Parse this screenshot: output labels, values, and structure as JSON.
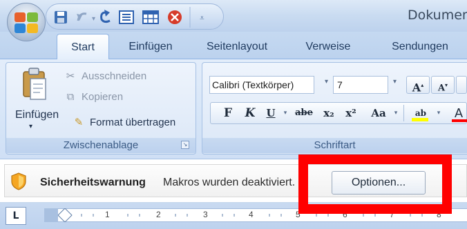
{
  "window": {
    "title": "Dokumen"
  },
  "quick_access": {
    "icons": [
      "save-icon",
      "undo-icon",
      "redo-icon",
      "list-icon",
      "table-icon",
      "close-doc-icon",
      "customize-icon"
    ]
  },
  "tabs": [
    {
      "label": "Start",
      "active": true
    },
    {
      "label": "Einfügen"
    },
    {
      "label": "Seitenlayout"
    },
    {
      "label": "Verweise"
    },
    {
      "label": "Sendungen"
    }
  ],
  "clipboard": {
    "paste_label": "Einfügen",
    "cut_label": "Ausschneiden",
    "copy_label": "Kopieren",
    "format_painter_label": "Format übertragen",
    "group_label": "Zwischenablage"
  },
  "font": {
    "font_name": "Calibri (Textkörper)",
    "font_size": "7",
    "group_label": "Schriftart",
    "bold_label": "F",
    "italic_label": "K",
    "underline_label": "U",
    "strike_label": "abe",
    "subscript_label": "x₂",
    "superscript_label": "x²",
    "case_label": "Aa",
    "highlight_label": "ab",
    "font_color_label": "A",
    "grow_label": "A",
    "shrink_label": "A",
    "highlight_color": "#ffff00",
    "font_color": "#ff0000"
  },
  "message_bar": {
    "title": "Sicherheitswarnung",
    "text": "Makros wurden deaktiviert.",
    "button_label": "Optionen..."
  },
  "ruler": {
    "tab_selector": "L",
    "numbers": [
      "1",
      "2",
      "3",
      "4",
      "5",
      "6",
      "7",
      "8"
    ]
  },
  "colors": {
    "highlight_frame": "#ff0000",
    "ribbon_blue": "#d6e5f7"
  }
}
